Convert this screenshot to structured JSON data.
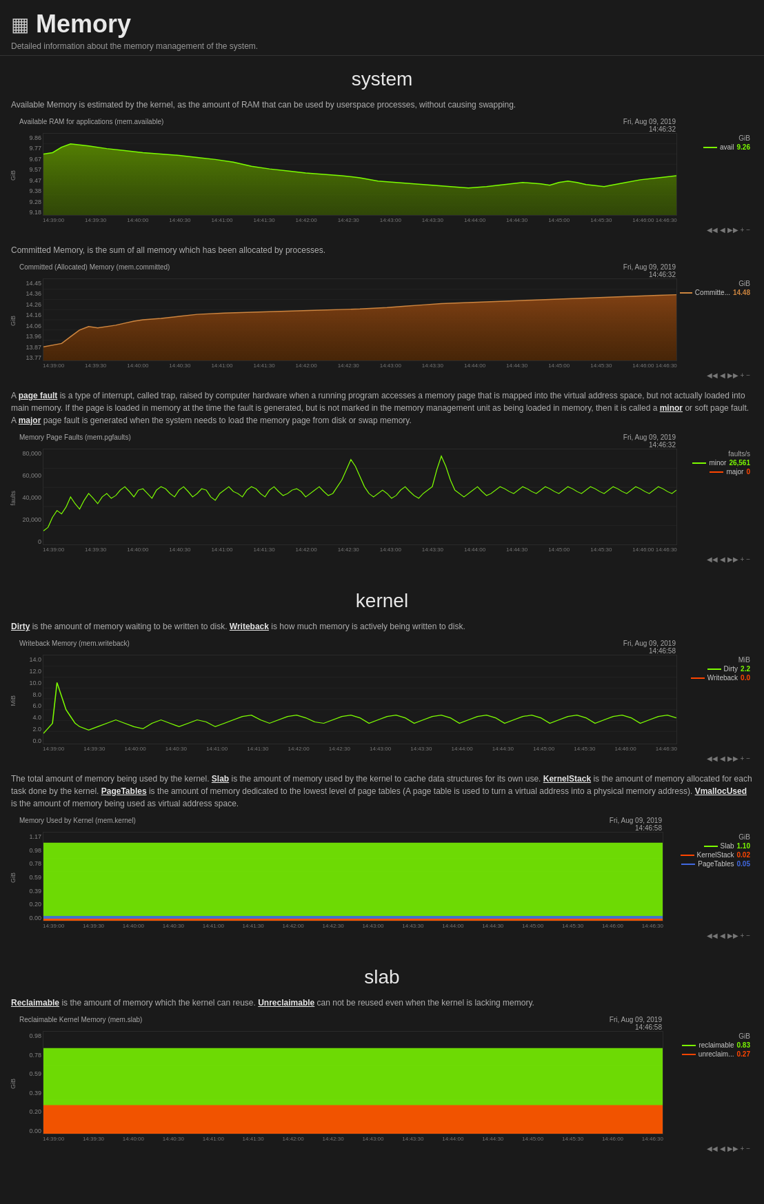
{
  "header": {
    "title": "Memory",
    "subtitle": "Detailed information about the memory management of the system.",
    "icon": "▦"
  },
  "sections": {
    "system": {
      "title": "system",
      "charts": [
        {
          "id": "avail-ram",
          "description_parts": [
            {
              "text": "Available Memory is estimated by the kernel, as the amount of RAM that can be used by userspace processes, without causing swapping.",
              "bold": false
            }
          ],
          "title": "Available RAM for applications (mem.available)",
          "timestamp": "Fri, Aug 09, 2019\n14:46:32",
          "unit": "GiB",
          "y_labels": [
            "9.86",
            "9.77",
            "9.67",
            "9.57",
            "9.47",
            "9.38",
            "9.28",
            "9.18"
          ],
          "x_labels": [
            "14:39:00",
            "14:39:30",
            "14:40:00",
            "14:40:30",
            "14:41:00",
            "14:41:30",
            "14:42:00",
            "14:42:30",
            "14:43:00",
            "14:43:30",
            "14:44:00",
            "14:44:30",
            "14:45:00",
            "14:45:30",
            "14:46:00 14:46:30"
          ],
          "series": [
            {
              "name": "avail",
              "color": "#5a8a00",
              "value": "9.26"
            }
          ],
          "axis_label": "GiB"
        },
        {
          "id": "committed-mem",
          "description_parts": [
            {
              "text": "Committed Memory, is the sum of all memory which has been allocated by processes.",
              "bold": false
            }
          ],
          "title": "Committed (Allocated) Memory (mem.committed)",
          "timestamp": "Fri, Aug 09, 2019\n14:46:32",
          "unit": "GiB",
          "y_labels": [
            "14.45",
            "14.36",
            "14.26",
            "14.16",
            "14.06",
            "13.96",
            "13.87",
            "13.77"
          ],
          "x_labels": [
            "14:39:00",
            "14:39:30",
            "14:40:00",
            "14:40:30",
            "14:41:00",
            "14:41:30",
            "14:42:00",
            "14:42:30",
            "14:43:00",
            "14:43:30",
            "14:44:00",
            "14:44:30",
            "14:45:00",
            "14:45:30",
            "14:46:00 14:46:30"
          ],
          "series": [
            {
              "name": "Committe...",
              "color": "#8b4513",
              "value": "14.48"
            }
          ],
          "axis_label": "GiB"
        },
        {
          "id": "page-faults",
          "description_html": "A page fault is a type of interrupt, called trap, raised by computer hardware when a running program accesses a memory page that is mapped into the virtual address space, but not actually loaded into main memory. If the page is loaded in memory at the time the fault is generated, but is not marked in the memory management unit as being loaded in memory, then it is called a minor or soft page fault. A major page fault is generated when the system needs to load the memory page from disk or swap memory.",
          "title": "Memory Page Faults (mem.pgfaults)",
          "timestamp": "Fri, Aug 09, 2019\n14:46:32",
          "unit": "faults/s",
          "y_labels": [
            "80,000",
            "60,000",
            "40,000",
            "20,000",
            "0"
          ],
          "x_labels": [
            "14:39:00",
            "14:39:30",
            "14:40:00",
            "14:40:30",
            "14:41:00",
            "14:41:30",
            "14:42:00",
            "14:42:30",
            "14:43:00",
            "14:43:30",
            "14:44:00",
            "14:44:30",
            "14:45:00",
            "14:45:30",
            "14:46:00 14:46:30"
          ],
          "series": [
            {
              "name": "minor",
              "color": "#7cfc00",
              "value": "26,561"
            },
            {
              "name": "major",
              "color": "#ff4500",
              "value": "0"
            }
          ],
          "axis_label": "faults"
        }
      ]
    },
    "kernel": {
      "title": "kernel",
      "charts": [
        {
          "id": "writeback-mem",
          "description_parts": [
            {
              "text": "Dirty",
              "bold": true
            },
            {
              "text": " is the amount of memory waiting to be written to disk. ",
              "bold": false
            },
            {
              "text": "Writeback",
              "bold": true
            },
            {
              "text": " is how much memory is actively being written to disk.",
              "bold": false
            }
          ],
          "title": "Writeback Memory (mem.writeback)",
          "timestamp": "Fri, Aug 09, 2019\n14:46:58",
          "unit": "MiB",
          "y_labels": [
            "14.0",
            "12.0",
            "10.0",
            "8.0",
            "6.0",
            "4.0",
            "2.0",
            "0.0"
          ],
          "x_labels": [
            "14:39:00",
            "14:39:30",
            "14:40:00",
            "14:40:30",
            "14:41:00",
            "14:41:30",
            "14:42:00",
            "14:42:30",
            "14:43:00",
            "14:43:30",
            "14:44:00",
            "14:44:30",
            "14:45:00",
            "14:45:30",
            "14:46:00",
            "14:46:30"
          ],
          "series": [
            {
              "name": "Dirty",
              "color": "#7cfc00",
              "value": "2.2"
            },
            {
              "name": "Writeback",
              "color": "#ff4500",
              "value": "0.0"
            }
          ],
          "axis_label": "MiB"
        },
        {
          "id": "kernel-mem",
          "description_html": "The total amount of memory being used by the kernel. Slab is the amount of memory used by the kernel to cache data structures for its own use. KernelStack is the amount of memory allocated for each task done by the kernel. PageTables is the amount of memory dedicated to the lowest level of page tables (A page table is used to turn a virtual address into a physical memory address). VmallocUsed is the amount of memory being used as virtual address space.",
          "title": "Memory Used by Kernel (mem.kernel)",
          "timestamp": "Fri, Aug 09, 2019\n14:46:58",
          "unit": "GiB",
          "y_labels": [
            "1.17",
            "0.98",
            "0.78",
            "0.59",
            "0.39",
            "0.20",
            "0.00"
          ],
          "x_labels": [
            "14:39:00",
            "14:39:30",
            "14:40:00",
            "14:40:30",
            "14:41:00",
            "14:41:30",
            "14:42:00",
            "14:42:30",
            "14:43:00",
            "14:43:30",
            "14:44:00",
            "14:44:30",
            "14:45:00",
            "14:45:30",
            "14:46:00",
            "14:46:30"
          ],
          "series": [
            {
              "name": "Slab",
              "color": "#7cfc00",
              "value": "1.10"
            },
            {
              "name": "KernelStack",
              "color": "#ff4500",
              "value": "0.02"
            },
            {
              "name": "PageTables",
              "color": "#4169e1",
              "value": "0.05"
            }
          ],
          "axis_label": "GiB"
        }
      ]
    },
    "slab": {
      "title": "slab",
      "charts": [
        {
          "id": "slab-mem",
          "description_parts": [
            {
              "text": "Reclaimable",
              "bold": true
            },
            {
              "text": " is the amount of memory which the kernel can reuse. ",
              "bold": false
            },
            {
              "text": "Unreclaimable",
              "bold": true
            },
            {
              "text": " can not be reused even when the kernel is lacking memory.",
              "bold": false
            }
          ],
          "title": "Reclaimable Kernel Memory (mem.slab)",
          "timestamp": "Fri, Aug 09, 2019\n14:46:58",
          "unit": "GiB",
          "y_labels": [
            "0.98",
            "0.78",
            "0.59",
            "0.39",
            "0.20",
            "0.00"
          ],
          "x_labels": [
            "14:39:00",
            "14:39:30",
            "14:40:00",
            "14:40:30",
            "14:41:00",
            "14:41:30",
            "14:42:00",
            "14:42:30",
            "14:43:00",
            "14:43:30",
            "14:44:00",
            "14:44:30",
            "14:45:00",
            "14:45:30",
            "14:46:00",
            "14:46:30"
          ],
          "series": [
            {
              "name": "reclaimable",
              "color": "#7cfc00",
              "value": "0.83"
            },
            {
              "name": "unreclaim...",
              "color": "#ff4500",
              "value": "0.27"
            }
          ],
          "axis_label": "GiB"
        }
      ]
    }
  },
  "nav_controls": [
    "◀◀",
    "◀",
    "▶▶",
    "+",
    "−"
  ]
}
